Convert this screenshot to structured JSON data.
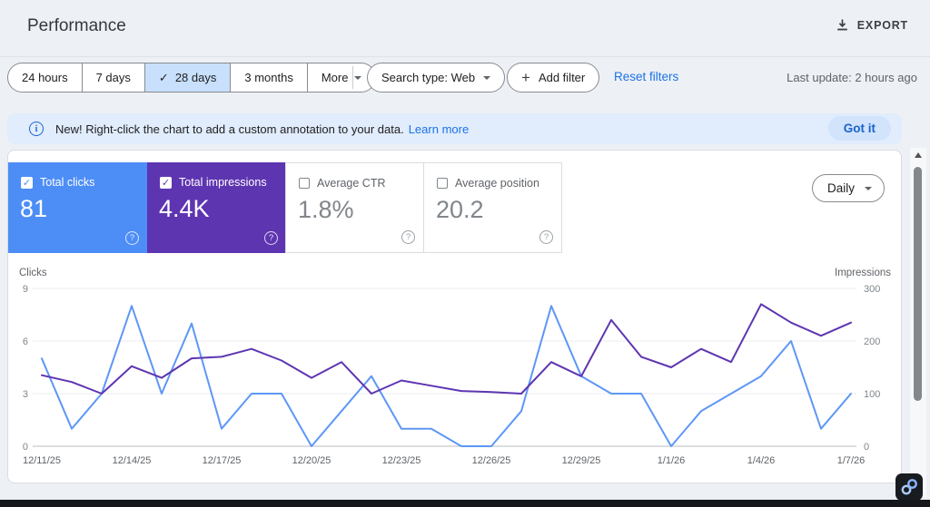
{
  "header": {
    "title": "Performance",
    "export_label": "EXPORT"
  },
  "filters": {
    "date_ranges": [
      "24 hours",
      "7 days",
      "28 days",
      "3 months"
    ],
    "selected_range": "28 days",
    "more_label": "More",
    "search_type_label": "Search type: Web",
    "add_filter_label": "Add filter",
    "reset_label": "Reset filters",
    "last_update": "Last update: 2 hours ago"
  },
  "banner": {
    "text": "New! Right-click the chart to add a custom annotation to your data.",
    "learn_more_label": "Learn more",
    "dismiss_label": "Got it"
  },
  "metrics": {
    "granularity": "Daily",
    "tiles": [
      {
        "label": "Total clicks",
        "value": "81",
        "selected": true,
        "color": "#4d8df6"
      },
      {
        "label": "Total impressions",
        "value": "4.4K",
        "selected": true,
        "color": "#5e35b1"
      },
      {
        "label": "Average CTR",
        "value": "1.8%",
        "selected": false,
        "color": "#ffffff"
      },
      {
        "label": "Average position",
        "value": "20.2",
        "selected": false,
        "color": "#ffffff"
      }
    ]
  },
  "chart_data": {
    "type": "line",
    "dates": [
      "12/11/25",
      "12/12/25",
      "12/13/25",
      "12/14/25",
      "12/15/25",
      "12/16/25",
      "12/17/25",
      "12/18/25",
      "12/19/25",
      "12/20/25",
      "12/21/25",
      "12/22/25",
      "12/23/25",
      "12/24/25",
      "12/25/25",
      "12/26/25",
      "12/27/25",
      "12/28/25",
      "12/29/25",
      "12/30/25",
      "12/31/25",
      "1/1/26",
      "1/2/26",
      "1/3/26",
      "1/4/26",
      "1/5/26",
      "1/6/26",
      "1/7/26"
    ],
    "x_tick_labels": [
      "12/11/25",
      "12/14/25",
      "12/17/25",
      "12/20/25",
      "12/23/25",
      "12/26/25",
      "12/29/25",
      "1/1/26",
      "1/4/26",
      "1/7/26"
    ],
    "series": [
      {
        "name": "Clicks",
        "axis": "left",
        "color": "#5e97f6",
        "values": [
          5,
          1,
          3,
          8,
          3,
          7,
          1,
          3,
          3,
          0,
          2,
          4,
          1,
          1,
          0,
          0,
          2,
          8,
          4,
          3,
          3,
          0,
          2,
          3,
          4,
          6,
          1,
          3
        ]
      },
      {
        "name": "Impressions",
        "axis": "right",
        "color": "#5e35b1",
        "values": [
          135,
          122,
          100,
          152,
          130,
          167,
          170,
          185,
          163,
          130,
          160,
          100,
          125,
          115,
          105,
          103,
          100,
          160,
          133,
          240,
          170,
          150,
          185,
          160,
          270,
          235,
          210,
          235
        ]
      }
    ],
    "left_axis": {
      "label": "Clicks",
      "ticks": [
        0,
        3,
        6,
        9
      ],
      "max": 9
    },
    "right_axis": {
      "label": "Impressions",
      "ticks": [
        0,
        100,
        200,
        300
      ],
      "max": 300
    },
    "grid": true,
    "legend_position": "none"
  }
}
